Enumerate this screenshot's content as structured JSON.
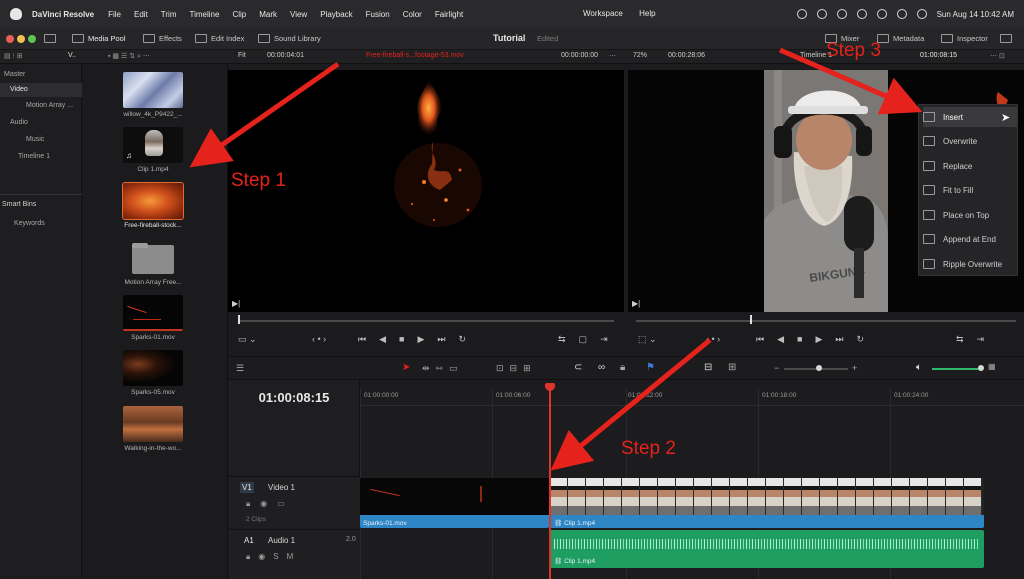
{
  "menubar": {
    "app": "DaVinci Resolve",
    "items": [
      "File",
      "Edit",
      "Trim",
      "Timeline",
      "Clip",
      "Mark",
      "View",
      "Playback",
      "Fusion",
      "Color",
      "Fairlight"
    ],
    "center_items": [
      "Workspace",
      "Help"
    ],
    "datetime": "Sun Aug 14  10:42 AM"
  },
  "toolbar": {
    "media_pool": "Media Pool",
    "effects": "Effects",
    "edit_index": "Edit Index",
    "sound_library": "Sound Library",
    "project_title": "Tutorial",
    "project_status": "Edited",
    "mixer": "Mixer",
    "metadata": "Metadata",
    "inspector": "Inspector"
  },
  "subbar": {
    "fit": "Fit",
    "source_tc": "00:00:04:01",
    "source_clip": "Free-fireball-s...footage-53.mov",
    "source_pos": "00:00:00:00",
    "zoom": "72%",
    "timeline_dur": "00:00:28:06",
    "timeline_name": "Timeline 1",
    "timeline_tc": "01:00:08:15"
  },
  "bins": {
    "master": "Master",
    "video": "Video",
    "motion_array": "Motion Array ...",
    "audio": "Audio",
    "music": "Music",
    "timeline": "Timeline 1",
    "smart_bins": "Smart Bins",
    "keywords": "Keywords"
  },
  "media_pool": {
    "clips": [
      {
        "label": "willow_4k_P9422_..."
      },
      {
        "label": "Clip 1.mp4"
      },
      {
        "label": "Free-fireball-stock..."
      },
      {
        "label": "Motion Array Free..."
      },
      {
        "label": "Sparks-01.mov"
      },
      {
        "label": "Sparks-05.mov"
      },
      {
        "label": "Walking-in-the-wo..."
      }
    ]
  },
  "edit_menu": {
    "items": [
      "Insert",
      "Overwrite",
      "Replace",
      "Fit to Fill",
      "Place on Top",
      "Append at End",
      "Ripple Overwrite"
    ]
  },
  "timeline": {
    "timecode": "01:00:08:15",
    "ruler": [
      "01:00:00:00",
      "01:00:06:00",
      "01:00:12:00",
      "01:00:18:00",
      "01:00:24:00"
    ],
    "video_track": {
      "id": "V1",
      "name": "Video 1",
      "clips_count": "2 Clips"
    },
    "audio_track": {
      "id": "A1",
      "name": "Audio 1",
      "level": "2.0"
    },
    "clips": {
      "v1_a": "Sparks-01.mov",
      "v1_b": "Clip 1.mp4",
      "a1": "Clip 1.mp4"
    }
  },
  "annotations": {
    "step1": "Step 1",
    "step2": "Step 2",
    "step3": "Step 3"
  },
  "colors": {
    "accent_red": "#e5221b",
    "video_clip": "#2f86c4",
    "audio_clip": "#1f9e62",
    "playhead": "#e0332a"
  }
}
